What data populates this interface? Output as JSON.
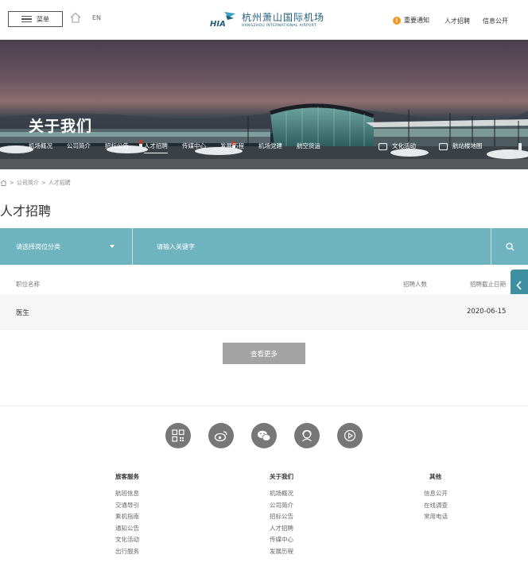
{
  "header": {
    "menu_label": "菜单",
    "lang_label": "EN",
    "logo_mark": "HIA",
    "logo_cn": "杭州萧山国际机场",
    "logo_en": "HANGZHOU INTERNATIONAL AIRPORT",
    "notice_label": "重要通知",
    "links": [
      "人才招聘",
      "信息公开"
    ]
  },
  "banner": {
    "title": "关于我们",
    "nav": [
      "机场概况",
      "公司简介",
      "招标公告",
      "人才招聘",
      "传媒中心",
      "发展历程",
      "机场党建",
      "航空货运"
    ],
    "active_nav": "人才招聘",
    "right_nav": [
      "文化活动",
      "航站楼地图"
    ]
  },
  "breadcrumb": [
    "公司简介",
    "人才招聘"
  ],
  "page_title": "人才招聘",
  "search": {
    "category_placeholder": "请选择岗位分类",
    "keyword_placeholder": "请输入关键字"
  },
  "table": {
    "headers": [
      "职位名称",
      "招聘人数",
      "招聘截止日期"
    ],
    "rows": [
      {
        "title": "医生",
        "count": "",
        "deadline": "2020-06-15"
      }
    ]
  },
  "more_label": "查看更多",
  "footer": {
    "social_icons": [
      "qrcode-icon",
      "weibo-icon",
      "wechat-icon",
      "service-icon",
      "video-icon"
    ],
    "columns": [
      {
        "title": "旅客服务",
        "links": [
          "航班信息",
          "交通导引",
          "乘机指南",
          "通知公告",
          "文化活动",
          "出行服务"
        ]
      },
      {
        "title": "关于我们",
        "links": [
          "机场概况",
          "公司简介",
          "招标公告",
          "人才招聘",
          "传媒中心",
          "发展历程"
        ]
      },
      {
        "title": "其他",
        "links": [
          "信息公开",
          "在线调查",
          "常用电话"
        ]
      }
    ]
  },
  "colors": {
    "accent": "#6fb3bf",
    "side_tab": "#3e8fa0",
    "button_gray": "#a3a3a3",
    "notice": "#f19a21"
  }
}
